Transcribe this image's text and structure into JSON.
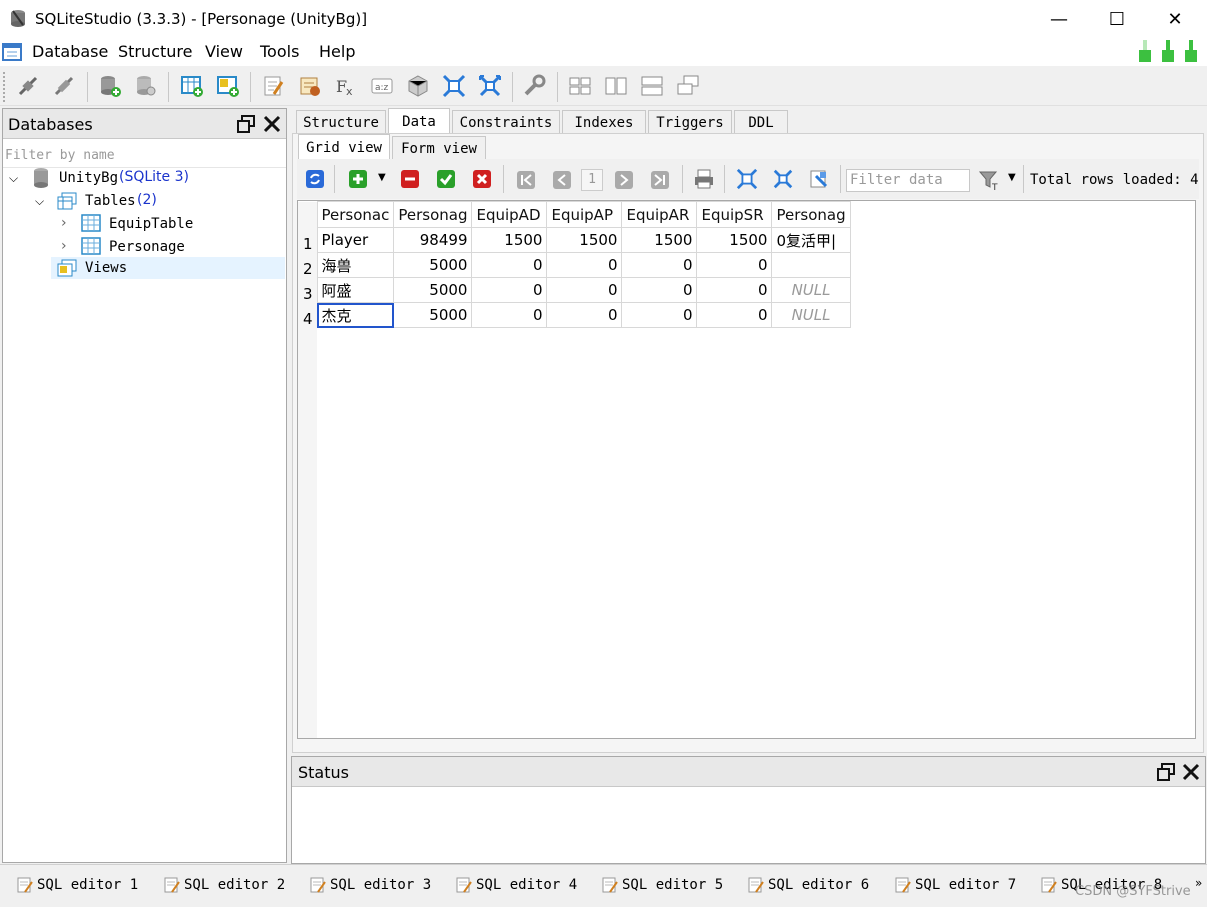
{
  "window": {
    "title": "SQLiteStudio (3.3.3) - [Personage (UnityBg)]",
    "minimize": "—",
    "maximize": "☐",
    "close": "✕"
  },
  "menu": [
    "Database",
    "Structure",
    "View",
    "Tools",
    "Help"
  ],
  "db_panel": {
    "title": "Databases",
    "filter_placeholder": "Filter by name",
    "db_name": "UnityBg",
    "db_type": "(SQLite 3)",
    "tables_label": "Tables",
    "tables_count": "(2)",
    "tables": [
      "EquipTable",
      "Personage"
    ],
    "views_label": "Views"
  },
  "main_tabs": [
    "Structure",
    "Data",
    "Constraints",
    "Indexes",
    "Triggers",
    "DDL"
  ],
  "sub_tabs": [
    "Grid view",
    "Form view"
  ],
  "data_toolbar": {
    "page": "1",
    "filter_placeholder": "Filter data",
    "total_rows": "Total rows loaded: 4"
  },
  "grid": {
    "columns": [
      "Personac",
      "Personag",
      "EquipAD",
      "EquipAP",
      "EquipAR",
      "EquipSR",
      "Personag"
    ],
    "rows": [
      {
        "n": "1",
        "cells": [
          "Player",
          "98499",
          "1500",
          "1500",
          "1500",
          "1500",
          "0复活甲|"
        ]
      },
      {
        "n": "2",
        "cells": [
          "海兽",
          "5000",
          "0",
          "0",
          "0",
          "0",
          ""
        ]
      },
      {
        "n": "3",
        "cells": [
          "阿盛",
          "5000",
          "0",
          "0",
          "0",
          "0",
          "NULL"
        ]
      },
      {
        "n": "4",
        "cells": [
          "杰克",
          "5000",
          "0",
          "0",
          "0",
          "0",
          "NULL"
        ]
      }
    ]
  },
  "status_panel": {
    "title": "Status"
  },
  "editors": [
    "SQL editor 1",
    "SQL editor 2",
    "SQL editor 3",
    "SQL editor 4",
    "SQL editor 5",
    "SQL editor 6",
    "SQL editor 7",
    "SQL editor 8"
  ],
  "watermark": "CSDN @SYFStrive",
  "colors": {
    "accent_blue": "#1a33cc",
    "selection": "#2255cc",
    "null_text": "#9a9a9a",
    "signal_green": "#3cc040"
  }
}
